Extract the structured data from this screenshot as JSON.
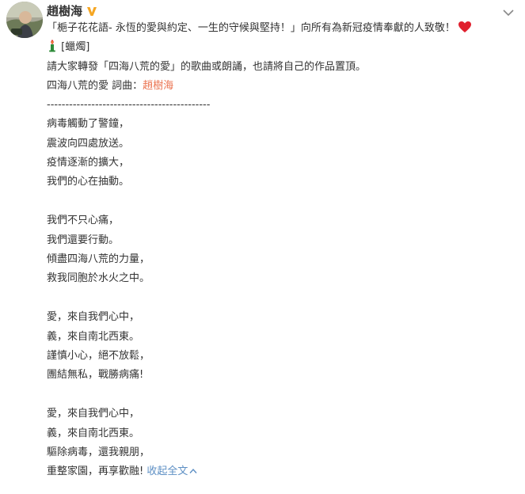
{
  "user": {
    "name": "趙樹海",
    "verified_badge_color": "#f5a623"
  },
  "post": {
    "title_line": "「梔子花花語- 永恆的愛與約定、一生的守候與堅持！」向所有為新冠疫情奉獻的人致敬！",
    "candle_label": "[蠟燭]",
    "request_line": "請大家轉發「四海八荒的愛」的歌曲或朗誦，也請將自己的作品置頂。",
    "credit_prefix": "四海八荒的愛 詞曲：",
    "credit_author": "趙樹海",
    "separator": "--------------------------------------------",
    "stanza1": [
      "病毒觸動了警鐘，",
      "震波向四處放送。",
      "疫情逐漸的擴大，",
      "我們的心在抽動。"
    ],
    "stanza2": [
      "我們不只心痛，",
      "我們還要行動。",
      "傾盡四海八荒的力量，",
      "救我同胞於水火之中。"
    ],
    "stanza3": [
      "愛，來自我們心中，",
      "義，來自南北西東。",
      "謹慎小心，絕不放鬆，",
      "團結無私，戰勝病痛!"
    ],
    "stanza4": [
      "愛，來自我們心中，",
      "義，來自南北西東。",
      "驅除病毒，還我親朋，"
    ],
    "last_line": "重整家園，再享歡融!",
    "collapse_label": "收起全文"
  },
  "icons": {
    "verified": "verified-v-icon",
    "heart": "heart-icon",
    "candle": "candle-icon",
    "menu": "chevron-down-icon",
    "collapse": "chevron-up-icon"
  },
  "colors": {
    "link_red": "#eb7350",
    "link_blue": "#5d8fc4",
    "heart": "#e0202e",
    "text": "#333333"
  }
}
